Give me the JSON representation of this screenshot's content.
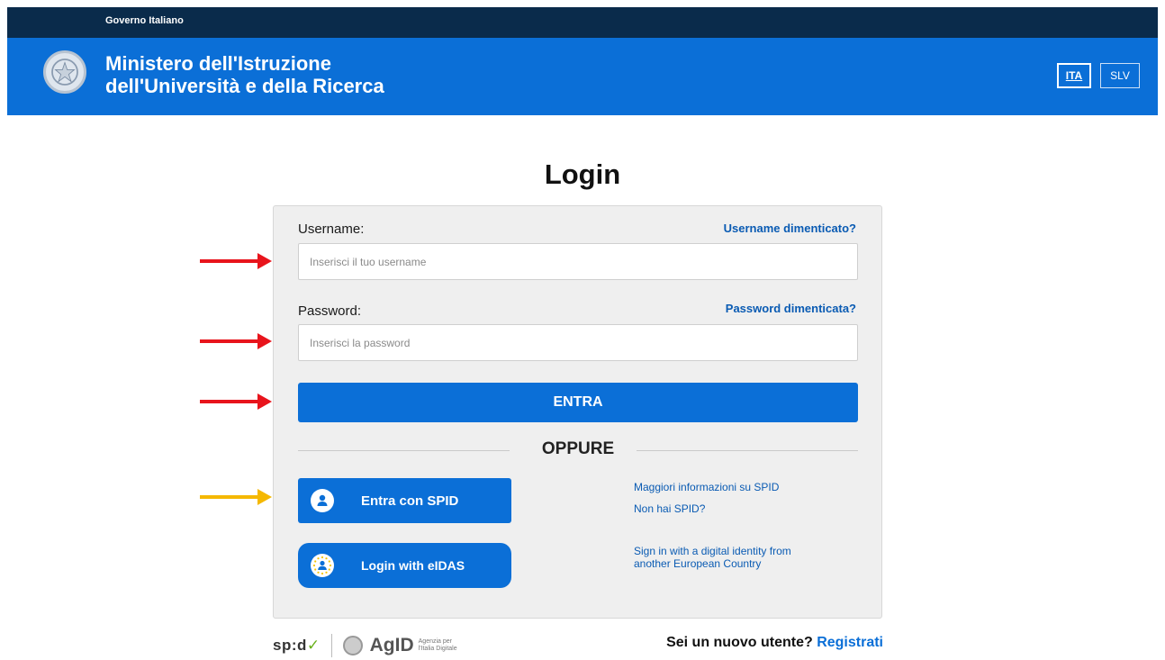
{
  "topbar": {
    "gov_label": "Governo Italiano"
  },
  "header": {
    "ministry_line1": "Ministero dell'Istruzione",
    "ministry_line2": "dell'Università e della Ricerca",
    "lang_active": "ITA",
    "lang_other": "SLV"
  },
  "page": {
    "title": "Login"
  },
  "form": {
    "username_label": "Username:",
    "username_forgot": "Username dimenticato?",
    "username_placeholder": "Inserisci il tuo username",
    "password_label": "Password:",
    "password_forgot": "Password dimenticata?",
    "password_placeholder": "Inserisci la password",
    "submit_label": "ENTRA",
    "or_label": "OPPURE"
  },
  "spid": {
    "button_label": "Entra con SPID",
    "info_link": "Maggiori informazioni su SPID",
    "no_spid_link": "Non hai SPID?"
  },
  "eidas": {
    "button_label": "Login with eIDAS",
    "info_line1": "Sign in with a digital identity from",
    "info_line2": "another European Country"
  },
  "footer": {
    "spid_logo": "sp:d",
    "agid_logo": "AgID",
    "agid_sub": "Agenzia per l'Italia Digitale",
    "new_user_text": "Sei un nuovo utente?",
    "register_link": "Registrati"
  },
  "colors": {
    "topbar": "#0a2b4b",
    "header": "#0b6fd7",
    "link": "#0a5bb3",
    "arrow_red": "#e8141c",
    "arrow_yellow": "#f5b800"
  }
}
